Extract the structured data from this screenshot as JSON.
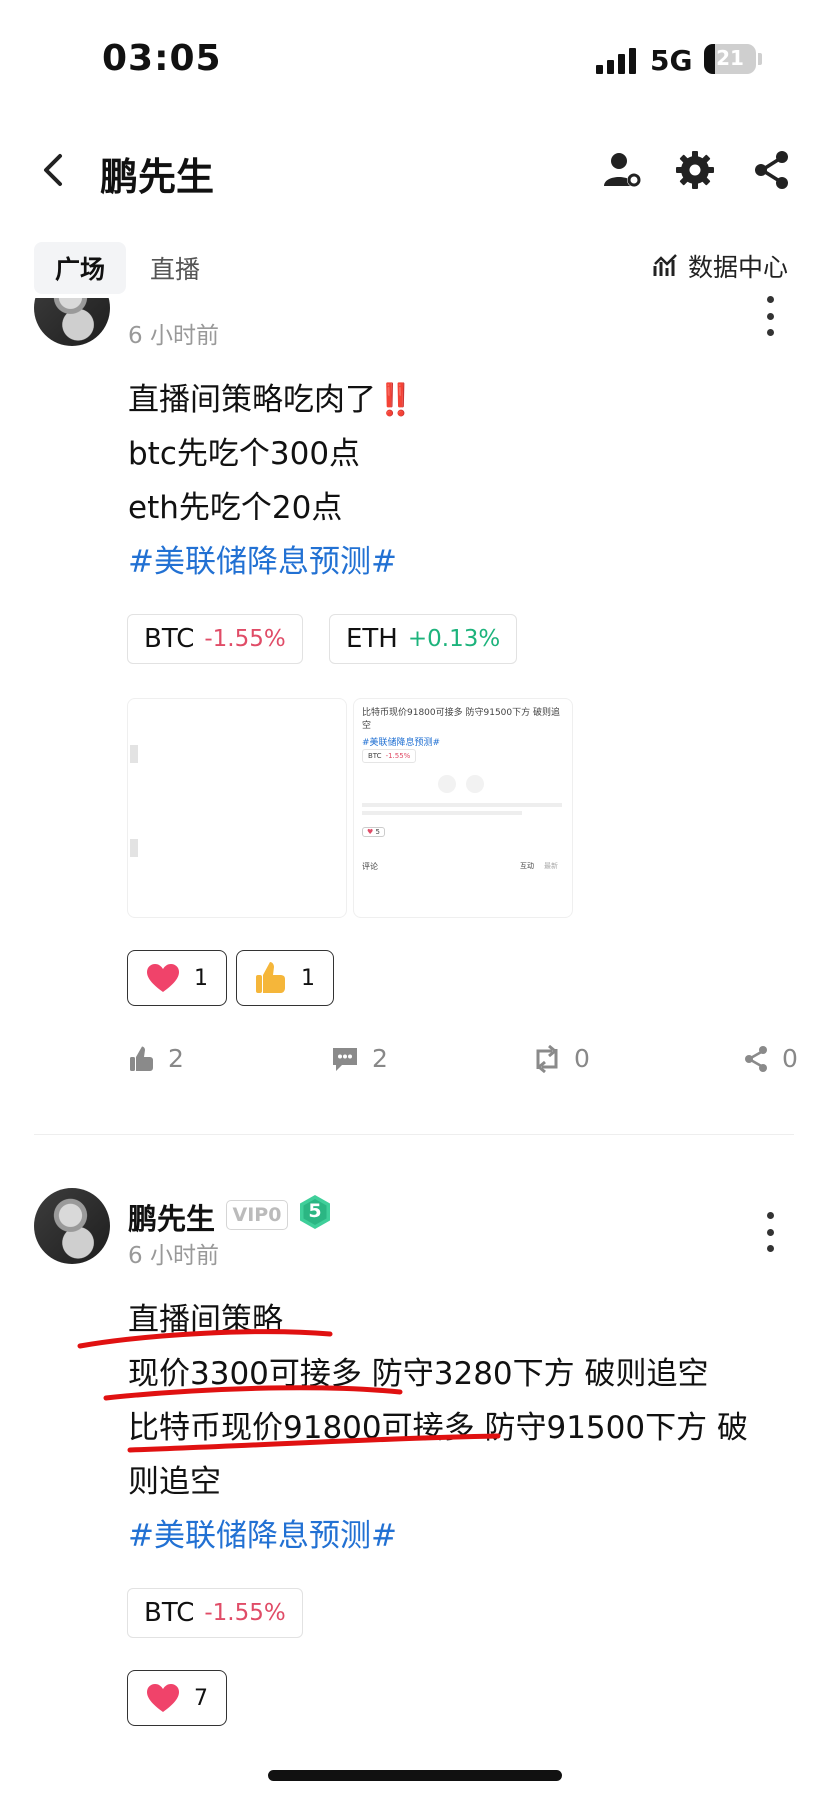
{
  "status_bar": {
    "time": "03:05",
    "network": "5G",
    "battery": "21",
    "battery_level": 0.21
  },
  "header": {
    "title": "鹏先生",
    "back_icon": "chevron-left-icon"
  },
  "tabs": [
    {
      "label": "广场",
      "active": true
    },
    {
      "label": "直播",
      "active": false
    }
  ],
  "data_center": {
    "label": "数据中心",
    "icon": "chart-icon"
  },
  "colors": {
    "negative": "#e04c67",
    "positive": "#1db37c",
    "link": "#2271d3",
    "annotation": "#e01111"
  },
  "post1": {
    "time": "6 小时前",
    "lines": [
      "直播间策略吃肉了‼️",
      "btc先吃个300点",
      "eth先吃个20点"
    ],
    "hashtag": "#美联储降息预测#",
    "tickers": [
      {
        "symbol": "BTC",
        "change": "-1.55%"
      },
      {
        "symbol": "ETH",
        "change": "+0.13%"
      }
    ],
    "preview": {
      "text": "比特币现价91800可接多 防守91500下方 破则追空",
      "hashtag": "#美联储降息预测#",
      "ticker": "BTC",
      "ticker_change": "-1.55%",
      "like_count": "5",
      "comments_label": "评论",
      "interact_label": "互动",
      "latest_label": "最新"
    },
    "reactions": [
      {
        "icon": "heart-icon",
        "count": "1"
      },
      {
        "icon": "thumbs-up-icon",
        "count": "1"
      }
    ],
    "actions": {
      "likes": "2",
      "comments": "2",
      "reposts": "0",
      "shares": "0"
    }
  },
  "post2": {
    "author": "鹏先生",
    "vip": "VIP0",
    "level": "5",
    "time": "6 小时前",
    "lines": [
      "直播间策略",
      "现价3300可接多 防守3280下方 破则追空",
      "比特币现价91800可接多 防守91500下方 破",
      "则追空"
    ],
    "hashtag": "#美联储降息预测#",
    "tickers": [
      {
        "symbol": "BTC",
        "change": "-1.55%"
      }
    ],
    "reactions": [
      {
        "icon": "heart-icon",
        "count": "7"
      }
    ]
  }
}
